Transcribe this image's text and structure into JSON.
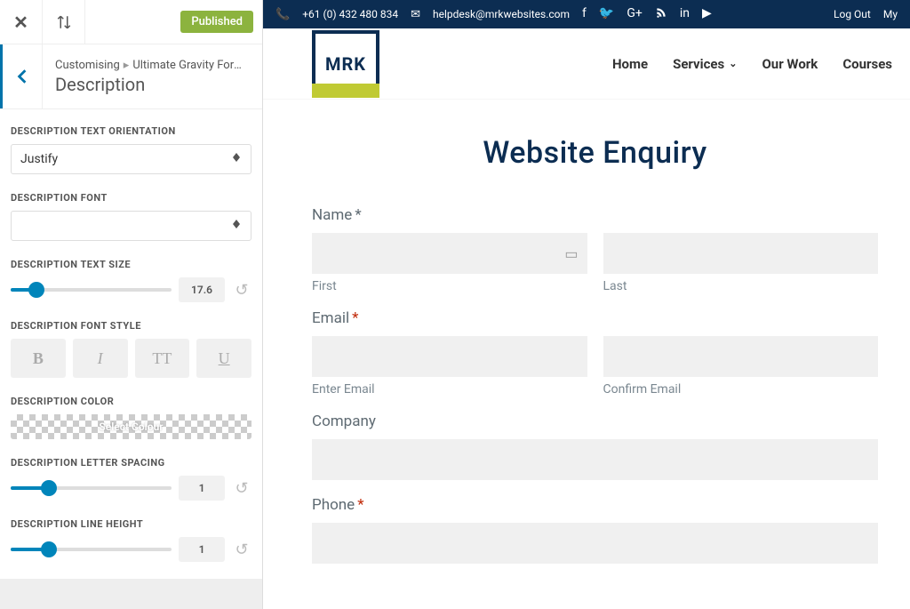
{
  "top": {
    "published": "Published",
    "breadcrumb_a": "Customising",
    "breadcrumb_b": "Ultimate Gravity Form…",
    "panel_title": "Description"
  },
  "ctrl": {
    "orientation_label": "DESCRIPTION TEXT ORIENTATION",
    "orientation_value": "Justify",
    "font_label": "DESCRIPTION FONT",
    "font_value": "",
    "size_label": "DESCRIPTION TEXT SIZE",
    "size_value": "17.6",
    "style_label": "DESCRIPTION FONT STYLE",
    "style_b": "B",
    "style_i": "I",
    "style_tt": "TT",
    "style_u": "U",
    "color_label": "DESCRIPTION COLOR",
    "color_btn": "Select Colour",
    "letter_label": "DESCRIPTION LETTER SPACING",
    "letter_value": "1",
    "line_label": "DESCRIPTION LINE HEIGHT",
    "line_value": "1"
  },
  "site": {
    "phone": "+61 (0) 432 480 834",
    "email": "helpdesk@mrkwebsites.com",
    "logout": "Log Out",
    "my": "My",
    "logo": "MRK",
    "nav": {
      "home": "Home",
      "services": "Services",
      "work": "Our Work",
      "courses": "Courses"
    }
  },
  "form": {
    "title": "Website Enquiry",
    "name": "Name",
    "first": "First",
    "last": "Last",
    "email": "Email",
    "enter_email": "Enter Email",
    "confirm_email": "Confirm Email",
    "company": "Company",
    "phone": "Phone",
    "star": "*"
  }
}
